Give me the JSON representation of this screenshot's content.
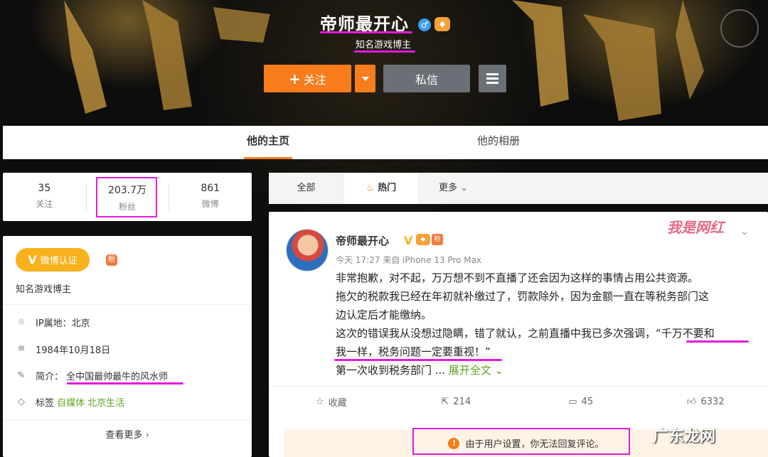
{
  "header": {
    "nickname": "帝师最开心",
    "gender_icon": "male-icon",
    "level_icon": "level-icon",
    "verify_text": "知名游戏博主",
    "follow_label": "关注",
    "message_label": "私信"
  },
  "tabs": {
    "home": "他的主页",
    "album": "他的相册"
  },
  "stats": [
    {
      "num": "35",
      "label": "关注"
    },
    {
      "num": "203.7万",
      "label": "粉丝"
    },
    {
      "num": "861",
      "label": "微博"
    }
  ],
  "profile": {
    "badge_label": "微博认证",
    "badge_letter": "V",
    "description": "知名游戏博主",
    "ip_label": "IP属地：北京",
    "birthday": "1984年10月18日",
    "intro_prefix": "简介：",
    "intro": "全中国最帅最牛的风水师",
    "tags_prefix": "标签",
    "tags": [
      "自媒体",
      "北京生活"
    ],
    "see_more": "查看更多"
  },
  "filters": {
    "all": "全部",
    "hot": "热门",
    "more": "更多"
  },
  "post": {
    "author": "帝师最开心",
    "meta": "今天 17:27 来自 iPhone 13 Pro Max",
    "watermark": "我是网红",
    "line1": "非常抱歉，对不起，万万想不到不直播了还会因为这样的事情占用公共资源。",
    "line2": "拖欠的税款我已经在年初就补缴过了，罚款除外，因为金额一直在等税务部门这",
    "line3": "边认定后才能缴纳。",
    "line4": "这次的错误我从没想过隐瞒，错了就认，之前直播中我已多次强调，“千万不要和",
    "line5": "我一样，税务问题一定要重视！”",
    "line6_prefix": "第一次收到税务部门 ...",
    "line6_expand": "展开全文",
    "actions": {
      "favorite": "收藏",
      "share": "214",
      "comment": "45",
      "like": "6332"
    },
    "notice": "由于用户设置，你无法回复评论。"
  },
  "site_watermark": "广东龙网",
  "colors": {
    "accent": "#f77c1b",
    "highlight": "#e21bdc",
    "link": "#5ea31c"
  }
}
